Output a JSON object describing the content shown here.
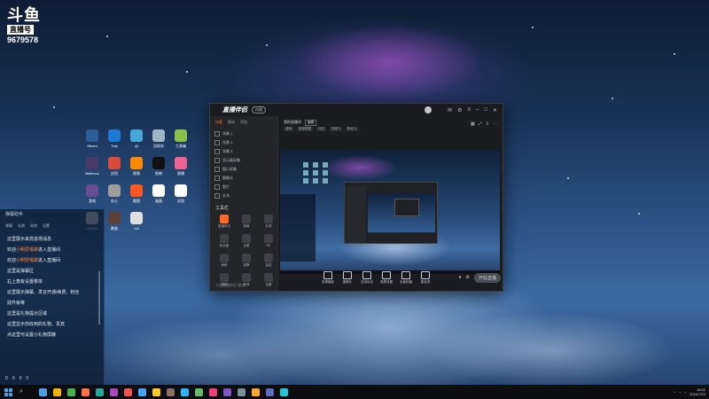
{
  "watermark": {
    "logo": "斗鱼",
    "sub": "直播号",
    "room_id": "9679578"
  },
  "desktop_icons": [
    {
      "label": "Steam",
      "color": "#2b5d9b"
    },
    {
      "label": "Trae",
      "color": "#1d78d6"
    },
    {
      "label": "Qt",
      "color": "#45a6d8"
    },
    {
      "label": "回收站",
      "color": "#9fb4c7"
    },
    {
      "label": "工具箱",
      "color": "#8bc34a"
    },
    {
      "label": "Bellevue",
      "color": "#4a3a6a"
    },
    {
      "label": "应用",
      "color": "#d94b3a"
    },
    {
      "label": "视频",
      "color": "#ff8a00"
    },
    {
      "label": "剪映",
      "color": "#111111"
    },
    {
      "label": "直播",
      "color": "#f06292"
    },
    {
      "label": "游戏",
      "color": "#6a4c93"
    },
    {
      "label": "办公",
      "color": "#9e9e9e"
    },
    {
      "label": "截图",
      "color": "#ff5722"
    },
    {
      "label": "画图",
      "color": "#ffffff"
    },
    {
      "label": "文档",
      "color": "#ffffff"
    },
    {
      "label": "XIAOMI",
      "color": "#cfd8dc"
    },
    {
      "label": "歌曲",
      "color": "#5d4037"
    },
    {
      "label": "nul",
      "color": "#e0e0e0"
    },
    {
      "label": "",
      "color": "transparent"
    },
    {
      "label": "",
      "color": "transparent"
    }
  ],
  "chat": {
    "header": "弹幕助手",
    "tabs": [
      "弹幕",
      "礼物",
      "贵宾",
      "设置"
    ],
    "lines": [
      {
        "prefix": "这里展示来宾进场消息",
        "hl": "",
        "suffix": ""
      },
      {
        "prefix": "欢迎",
        "hl": "小明爱唱歌",
        "suffix": "进入直播间"
      },
      {
        "prefix": "欢迎",
        "hl": "小明爱唱歌",
        "suffix": "进入直播间"
      },
      {
        "prefix": "这里是弹幕区",
        "hl": "",
        "suffix": ""
      },
      {
        "prefix": "右上角有设置菜单",
        "hl": "",
        "suffix": ""
      },
      {
        "prefix": "这里展示弹幕、发言开通/续费、粉丝",
        "hl": "",
        "suffix": ""
      },
      {
        "prefix": "勋升级等",
        "hl": "",
        "suffix": ""
      },
      {
        "prefix": "这里是礼物提示区域",
        "hl": "",
        "suffix": ""
      },
      {
        "prefix": "这里显示你收到的礼物、贵宾",
        "hl": "",
        "suffix": ""
      },
      {
        "prefix": "点这里可设置小礼物屏蔽",
        "hl": "",
        "suffix": ""
      }
    ],
    "footer": [
      "0",
      "0",
      "0",
      "0"
    ]
  },
  "app": {
    "logo_text": "直播伴侣",
    "badge": "内测",
    "side_tabs": [
      "场景",
      "素材",
      "添加"
    ],
    "scenes": [
      "场景 1",
      "场景 2",
      "场景 3",
      "显示器采集",
      "窗口采集",
      "摄像头",
      "图片",
      "文本"
    ],
    "tools_label": "工具栏",
    "tools": [
      {
        "label": "直播助手",
        "accent": true
      },
      {
        "label": "弹幕",
        "accent": false
      },
      {
        "label": "礼物",
        "accent": false
      },
      {
        "label": "粉丝团",
        "accent": false
      },
      {
        "label": "连麦",
        "accent": false
      },
      {
        "label": "PK",
        "accent": false
      },
      {
        "label": "美颜",
        "accent": false
      },
      {
        "label": "投票",
        "accent": false
      },
      {
        "label": "抽奖",
        "accent": false
      },
      {
        "label": "更多",
        "accent": false
      },
      {
        "label": "音效",
        "accent": false
      },
      {
        "label": "设置",
        "accent": false
      }
    ],
    "side_footer": "斗鱼直播伴侣 版本",
    "room_title": "我的直播间",
    "room_tag": "编辑",
    "room_meta": [
      "游戏",
      "英雄联盟",
      "分区",
      "热度 0",
      "粉丝 0"
    ],
    "bottom_buttons": [
      "多屏播放",
      "摄像头",
      "互动玩法",
      "录屏设置",
      "全景拍摄",
      "麦克风"
    ],
    "live_button": "开始直播"
  },
  "taskbar": {
    "apps": [
      "#4aa0e6",
      "#f4b400",
      "#4caf50",
      "#ff7043",
      "#26a69a",
      "#ab47bc",
      "#ef5350",
      "#42a5f5",
      "#ffca28",
      "#8d6e63",
      "#29b6f6",
      "#66bb6a",
      "#ec407a",
      "#7e57c2",
      "#78909c",
      "#ffa726",
      "#5c6bc0",
      "#26c6da"
    ],
    "time": "16:02",
    "date": "2024/7/24"
  }
}
